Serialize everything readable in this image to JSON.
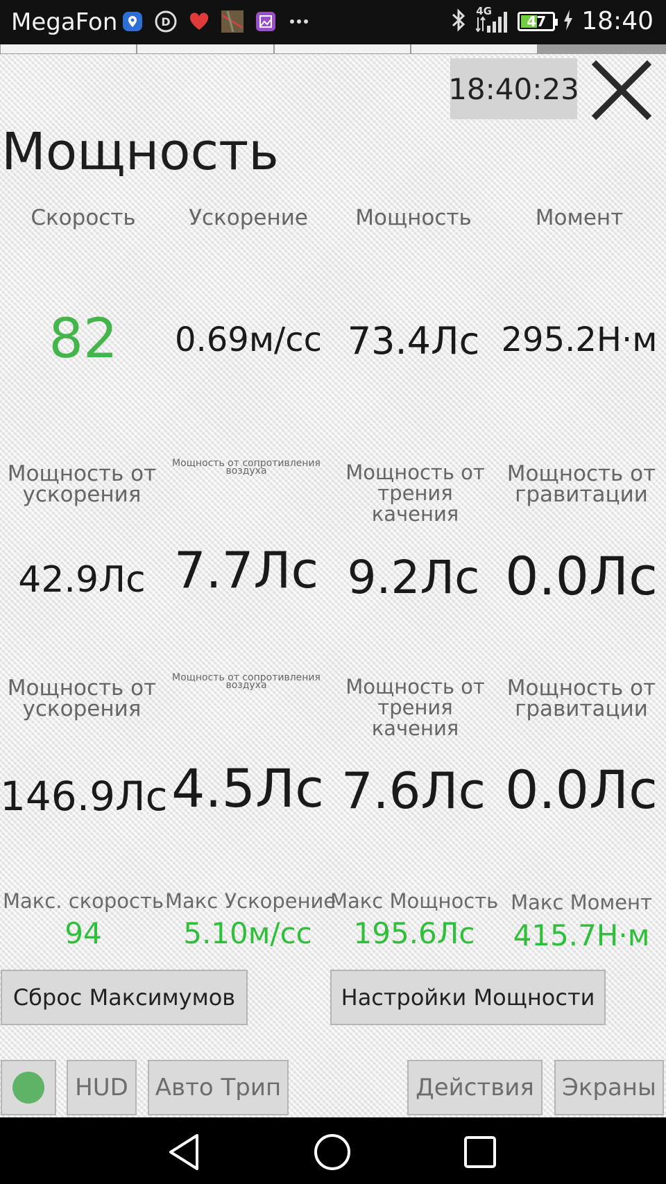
{
  "status_bar": {
    "carrier": "MegaFon",
    "time": "18:40",
    "battery_level": "47",
    "network": "4G",
    "notification_icons": [
      "location-icon",
      "app-d-icon",
      "heart-icon",
      "map-thumbnail-icon",
      "gallery-icon",
      "more-icon"
    ]
  },
  "header": {
    "clock": "18:40:23",
    "title": "Мощность"
  },
  "row1": {
    "labels": [
      "Скорость",
      "Ускорение",
      "Мощность",
      "Момент"
    ],
    "values": [
      "82",
      "0.69м/сс",
      "73.4Лс",
      "295.2Н·м"
    ]
  },
  "row2": {
    "labels": [
      "Мощность от ускорения",
      "Мощность от сопротивления воздуха",
      "Мощность от трения качения",
      "Мощность от гравитации"
    ],
    "values": [
      "42.9Лс",
      "7.7Лс",
      "9.2Лс",
      "0.0Лс"
    ]
  },
  "row3": {
    "labels": [
      "Мощность от ускорения",
      "Мощность от сопротивления воздуха",
      "Мощность от трения качения",
      "Мощность от гравитации"
    ],
    "values": [
      "146.9Лс",
      "4.5Лс",
      "7.6Лс",
      "0.0Лс"
    ]
  },
  "max": {
    "labels": [
      "Макс. скорость",
      "Макс Ускорение",
      "Макс Мощность",
      "Макс Момент"
    ],
    "values": [
      "94",
      "5.10м/сс",
      "195.6Лс",
      "415.7Н·м"
    ]
  },
  "buttons": {
    "reset_max": "Сброс Максимумов",
    "power_settings": "Настройки Мощности"
  },
  "toolbar": {
    "hud": "HUD",
    "auto_trip": "Авто Трип",
    "actions": "Действия",
    "screens": "Экраны"
  },
  "colors": {
    "accent_green": "#43b54a",
    "max_green": "#2fbf3a",
    "indicator": "#5fb367"
  }
}
